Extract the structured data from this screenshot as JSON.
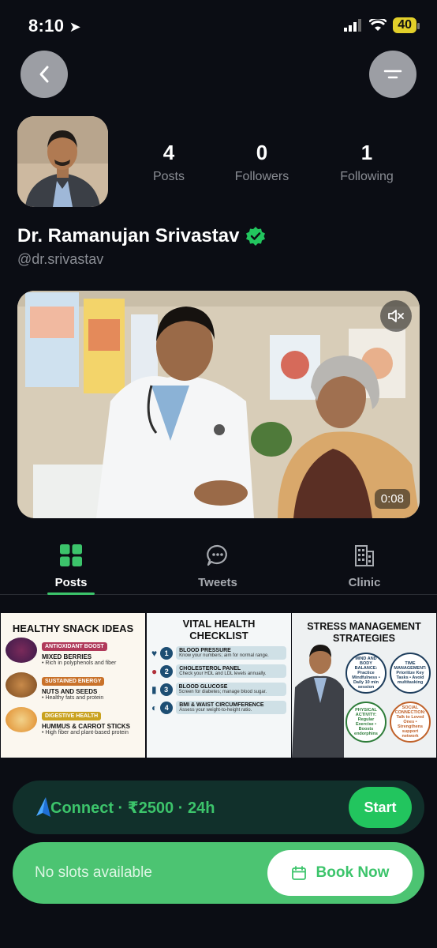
{
  "status": {
    "time": "8:10",
    "battery": "40"
  },
  "profile": {
    "name": "Dr. Ramanujan Srivastav",
    "handle": "@dr.srivastav",
    "stats": [
      {
        "value": "4",
        "label": "Posts"
      },
      {
        "value": "0",
        "label": "Followers"
      },
      {
        "value": "1",
        "label": "Following"
      }
    ]
  },
  "video": {
    "duration": "0:08"
  },
  "tabs": [
    {
      "label": "Posts",
      "icon": "grid-icon",
      "active": true
    },
    {
      "label": "Tweets",
      "icon": "chat-bubble-icon",
      "active": false
    },
    {
      "label": "Clinic",
      "icon": "building-icon",
      "active": false
    }
  ],
  "posts": {
    "snack": {
      "title": "HEALTHY SNACK IDEAS",
      "items": [
        {
          "tag": "ANTIOXIDANT BOOST",
          "name": "MIXED BERRIES",
          "desc": "• Rich in polyphenols and fiber"
        },
        {
          "tag": "SUSTAINED ENERGY",
          "name": "NUTS AND SEEDS",
          "desc": "• Healthy fats and protein"
        },
        {
          "tag": "DIGESTIVE HEALTH",
          "name": "HUMMUS & CARROT STICKS",
          "desc": "• High fiber and plant-based protein"
        }
      ]
    },
    "vital": {
      "title": "VITAL HEALTH CHECKLIST",
      "items": [
        {
          "num": "1",
          "head": "BLOOD PRESSURE",
          "desc": "Know your numbers; aim for normal range."
        },
        {
          "num": "2",
          "head": "CHOLESTEROL PANEL",
          "desc": "Check your HDL and LDL levels annually."
        },
        {
          "num": "3",
          "head": "BLOOD GLUCOSE",
          "desc": "Screen for diabetes; manage blood sugar."
        },
        {
          "num": "4",
          "head": "BMI & WAIST CIRCUMFERENCE",
          "desc": "Assess your weight-to-height ratio."
        }
      ]
    },
    "stress": {
      "title": "STRESS MANAGEMENT STRATEGIES",
      "badges": [
        "MIND AND BODY BALANCE: Practice Mindfulness • Daily 10 min session",
        "TIME MANAGEMENT: Prioritize Key Tasks • Avoid multitasking",
        "PHYSICAL ACTIVITY: Regular Exercise • Boosts endorphins",
        "SOCIAL CONNECTION: Talk to Loved Ones • Strengthens support network"
      ]
    }
  },
  "connect": {
    "label": "Connect · ₹2500 · 24h",
    "start": "Start"
  },
  "booking": {
    "status": "No slots available",
    "button": "Book Now"
  },
  "colors": {
    "accent": "#22c55e",
    "background": "#0b0d14",
    "verified": "#22c55e"
  }
}
